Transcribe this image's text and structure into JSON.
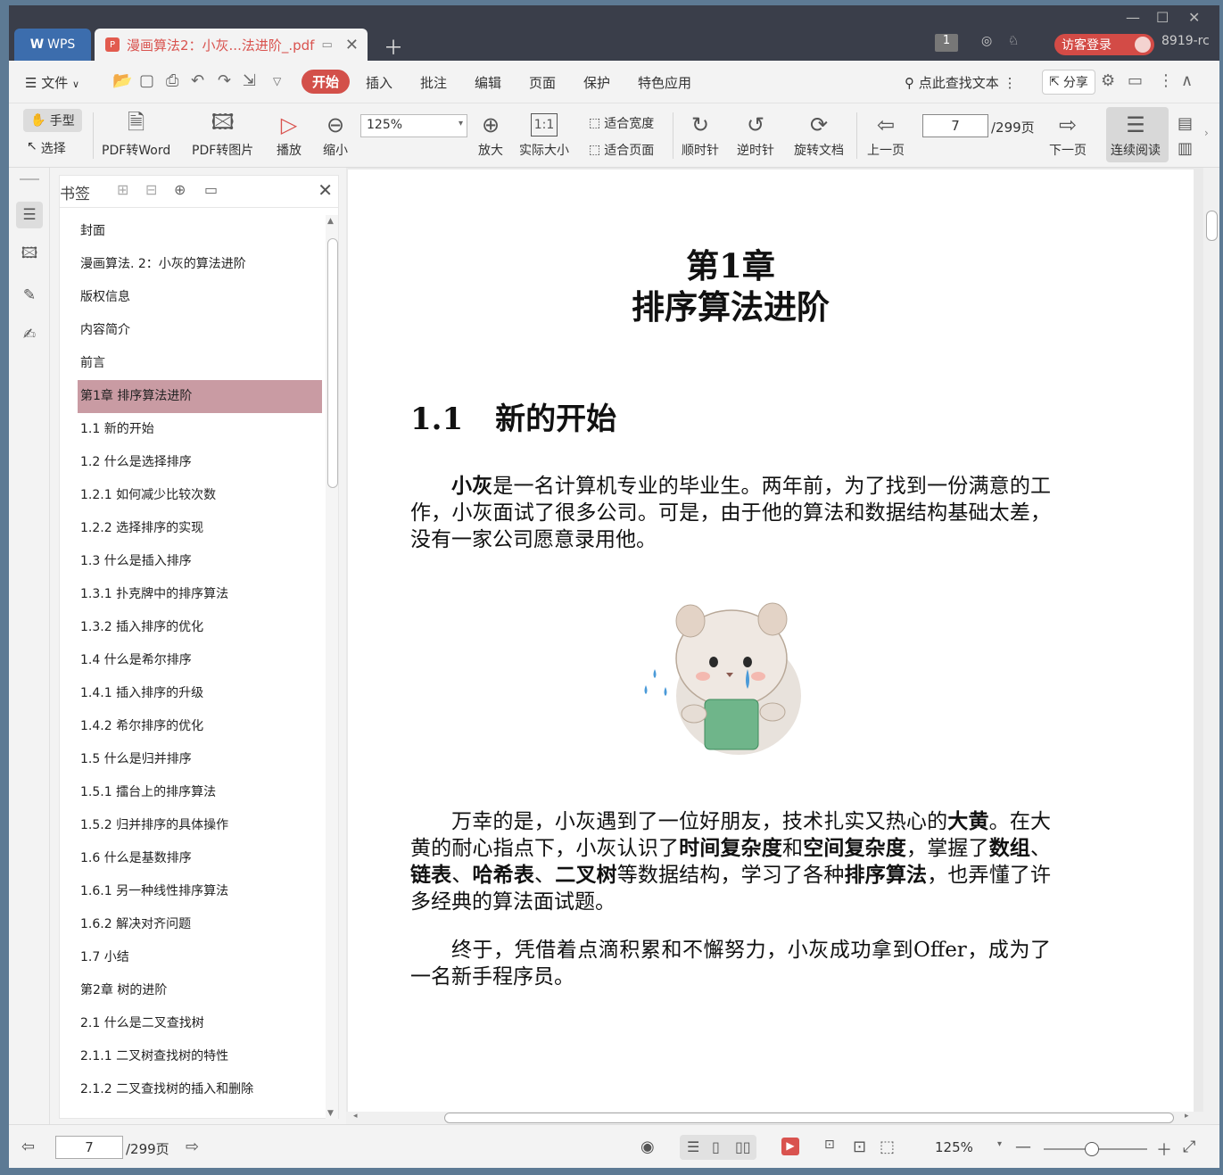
{
  "titlebar": {
    "app_tab": "WPS",
    "doc_tab": "漫画算法2：小灰...法进阶_.pdf",
    "tab_count": "1",
    "login": "访客登录",
    "user_id": "8919-rc"
  },
  "menu": {
    "file": "文件",
    "items": [
      "开始",
      "插入",
      "批注",
      "编辑",
      "页面",
      "保护",
      "特色应用"
    ],
    "search": "点此查找文本",
    "share": "分享"
  },
  "toolbar": {
    "hand": "手型",
    "select": "选择",
    "pdf_word": "PDF转Word",
    "pdf_image": "PDF转图片",
    "play": "播放",
    "zoom_out": "缩小",
    "zoom_value": "125%",
    "zoom_in": "放大",
    "actual_size": "实际大小",
    "fit_width": "适合宽度",
    "fit_page": "适合页面",
    "clockwise": "顺时针",
    "counter_clockwise": "逆时针",
    "rotate_doc": "旋转文档",
    "prev_page": "上一页",
    "page_number": "7",
    "page_total": "/299页",
    "next_page": "下一页",
    "continuous": "连续阅读"
  },
  "bookmarks": {
    "title": "书签",
    "active_index": 5,
    "items": [
      "封面",
      "漫画算法. 2：小灰的算法进阶",
      "版权信息",
      "内容简介",
      "前言",
      "第1章 排序算法进阶",
      "1.1 新的开始",
      "1.2 什么是选择排序",
      "1.2.1 如何减少比较次数",
      "1.2.2 选择排序的实现",
      "1.3 什么是插入排序",
      "1.3.1 扑克牌中的排序算法",
      "1.3.2 插入排序的优化",
      "1.4 什么是希尔排序",
      "1.4.1 插入排序的升级",
      "1.4.2 希尔排序的优化",
      "1.5 什么是归并排序",
      "1.5.1 擂台上的排序算法",
      "1.5.2 归并排序的具体操作",
      "1.6 什么是基数排序",
      "1.6.1 另一种线性排序算法",
      "1.6.2 解决对齐问题",
      "1.7 小结",
      "第2章 树的进阶",
      "2.1 什么是二叉查找树",
      "2.1.1 二叉树查找树的特性",
      "2.1.2 二叉查找树的插入和删除"
    ]
  },
  "document": {
    "chapter_num": "第1章",
    "chapter_title": "排序算法进阶",
    "section_num": "1.1",
    "section_title": "新的开始",
    "para1": [
      {
        "t": "小灰",
        "b": true
      },
      {
        "t": "是一名计算机专业的毕业生。两年前，为了找到一份满意的工作，小灰面试了很多公司。可是，由于他的算法和数据结构基础太差，没有一家公司愿意录用他。",
        "b": false
      }
    ],
    "para2": [
      {
        "t": "万幸的是，小灰遇到了一位好朋友，技术扎实又热心的",
        "b": false
      },
      {
        "t": "大黄",
        "b": true
      },
      {
        "t": "。在大黄的耐心指点下，小灰认识了",
        "b": false
      },
      {
        "t": "时间复杂度",
        "b": true
      },
      {
        "t": "和",
        "b": false
      },
      {
        "t": "空间复杂度",
        "b": true
      },
      {
        "t": "，掌握了",
        "b": false
      },
      {
        "t": "数组",
        "b": true
      },
      {
        "t": "、",
        "b": false
      },
      {
        "t": "链表",
        "b": true
      },
      {
        "t": "、",
        "b": false
      },
      {
        "t": "哈希表",
        "b": true
      },
      {
        "t": "、",
        "b": false
      },
      {
        "t": "二叉树",
        "b": true
      },
      {
        "t": "等数据结构，学习了各种",
        "b": false
      },
      {
        "t": "排序算法",
        "b": true
      },
      {
        "t": "，也弄懂了许多经典的算法面试题。",
        "b": false
      }
    ],
    "para3": [
      {
        "t": "终于，凭借着点滴积累和不懈努力，小灰成功拿到Offer，成为了一名新手程序员。",
        "b": false
      }
    ]
  },
  "statusbar": {
    "page_number": "7",
    "page_total": "/299页",
    "zoom": "125%"
  }
}
